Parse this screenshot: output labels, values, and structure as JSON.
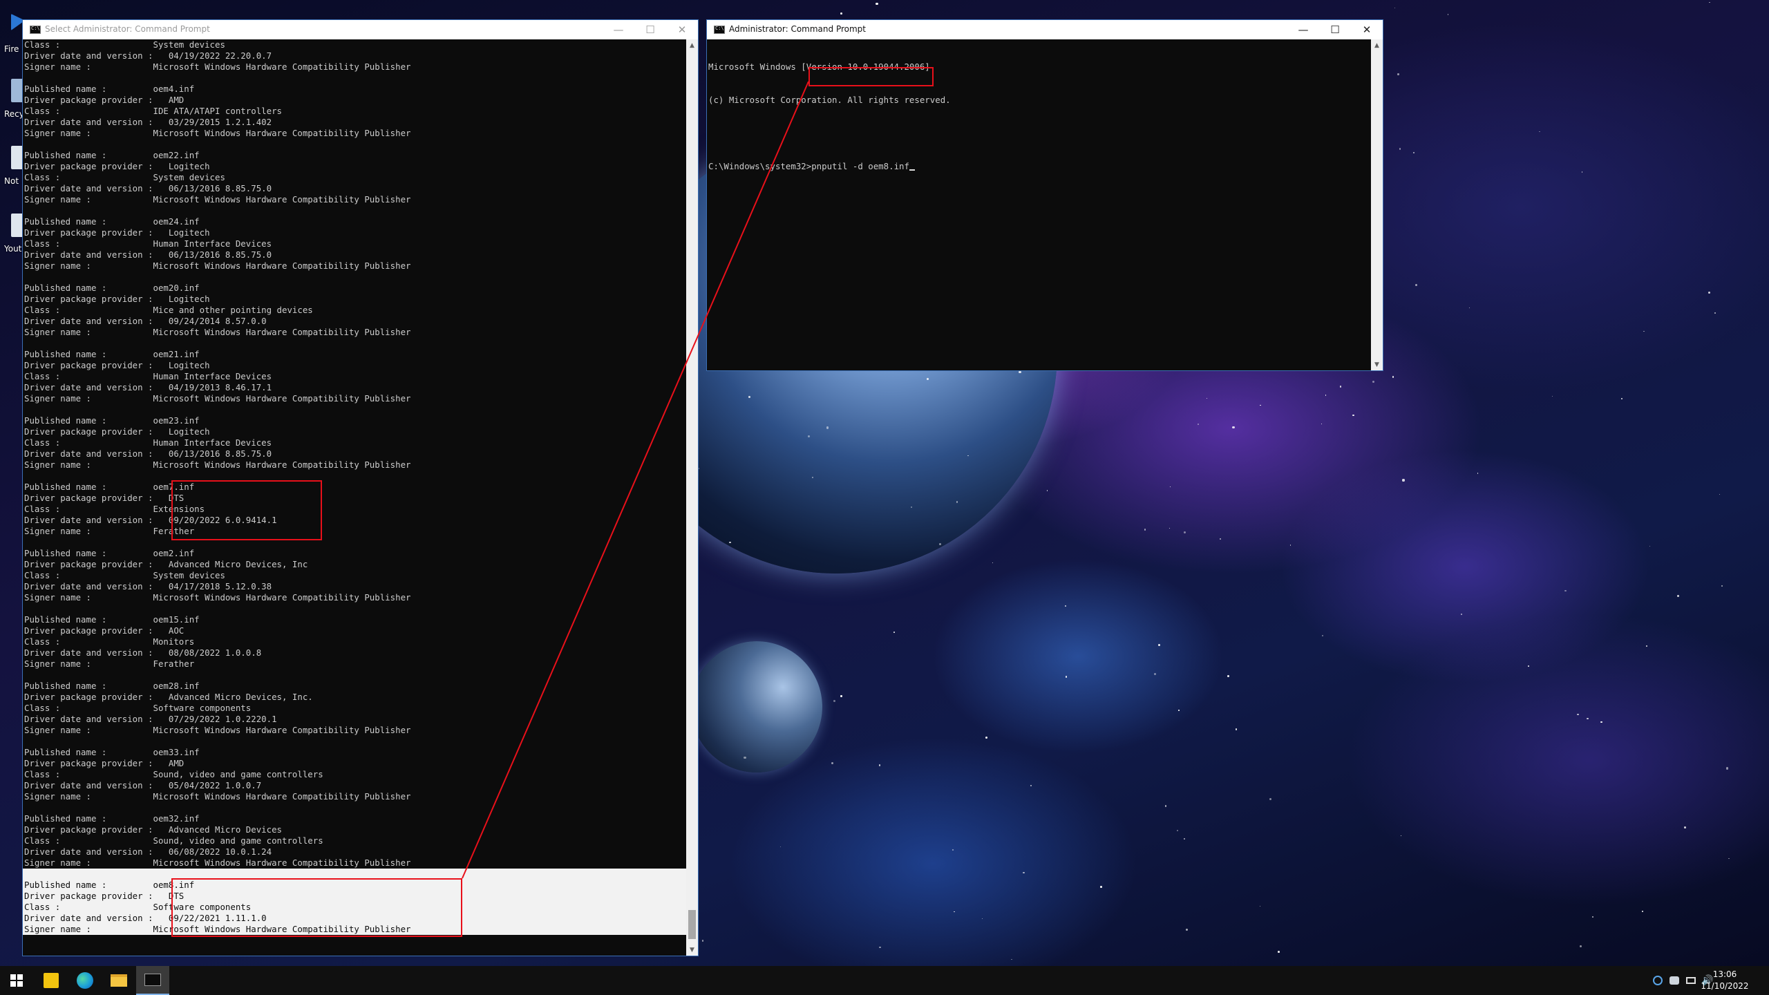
{
  "desktop": {
    "icons": [
      {
        "label": "Fire"
      },
      {
        "label": "Recy"
      },
      {
        "label": "Not"
      },
      {
        "label": "Yout"
      }
    ]
  },
  "left_window": {
    "title": "Select Administrator: Command Prompt",
    "lines": [
      "Class :                  System devices",
      "Driver date and version :   04/19/2022 22.20.0.7",
      "Signer name :            Microsoft Windows Hardware Compatibility Publisher",
      "",
      "Published name :         oem4.inf",
      "Driver package provider :   AMD",
      "Class :                  IDE ATA/ATAPI controllers",
      "Driver date and version :   03/29/2015 1.2.1.402",
      "Signer name :            Microsoft Windows Hardware Compatibility Publisher",
      "",
      "Published name :         oem22.inf",
      "Driver package provider :   Logitech",
      "Class :                  System devices",
      "Driver date and version :   06/13/2016 8.85.75.0",
      "Signer name :            Microsoft Windows Hardware Compatibility Publisher",
      "",
      "Published name :         oem24.inf",
      "Driver package provider :   Logitech",
      "Class :                  Human Interface Devices",
      "Driver date and version :   06/13/2016 8.85.75.0",
      "Signer name :            Microsoft Windows Hardware Compatibility Publisher",
      "",
      "Published name :         oem20.inf",
      "Driver package provider :   Logitech",
      "Class :                  Mice and other pointing devices",
      "Driver date and version :   09/24/2014 8.57.0.0",
      "Signer name :            Microsoft Windows Hardware Compatibility Publisher",
      "",
      "Published name :         oem21.inf",
      "Driver package provider :   Logitech",
      "Class :                  Human Interface Devices",
      "Driver date and version :   04/19/2013 8.46.17.1",
      "Signer name :            Microsoft Windows Hardware Compatibility Publisher",
      "",
      "Published name :         oem23.inf",
      "Driver package provider :   Logitech",
      "Class :                  Human Interface Devices",
      "Driver date and version :   06/13/2016 8.85.75.0",
      "Signer name :            Microsoft Windows Hardware Compatibility Publisher",
      "",
      "Published name :         oem7.inf",
      "Driver package provider :   DTS",
      "Class :                  Extensions",
      "Driver date and version :   09/20/2022 6.0.9414.1",
      "Signer name :            Ferather",
      "",
      "Published name :         oem2.inf",
      "Driver package provider :   Advanced Micro Devices, Inc",
      "Class :                  System devices",
      "Driver date and version :   04/17/2018 5.12.0.38",
      "Signer name :            Microsoft Windows Hardware Compatibility Publisher",
      "",
      "Published name :         oem15.inf",
      "Driver package provider :   AOC",
      "Class :                  Monitors",
      "Driver date and version :   08/08/2022 1.0.0.8",
      "Signer name :            Ferather",
      "",
      "Published name :         oem28.inf",
      "Driver package provider :   Advanced Micro Devices, Inc.",
      "Class :                  Software components",
      "Driver date and version :   07/29/2022 1.0.2220.1",
      "Signer name :            Microsoft Windows Hardware Compatibility Publisher",
      "",
      "Published name :         oem33.inf",
      "Driver package provider :   AMD",
      "Class :                  Sound, video and game controllers",
      "Driver date and version :   05/04/2022 1.0.0.7",
      "Signer name :            Microsoft Windows Hardware Compatibility Publisher",
      "",
      "Published name :         oem32.inf",
      "Driver package provider :   Advanced Micro Devices",
      "Class :                  Sound, video and game controllers",
      "Driver date and version :   06/08/2022 10.0.1.24",
      "Signer name :            Microsoft Windows Hardware Compatibility Publisher",
      "",
      "Published name :         oem8.inf",
      "Driver package provider :   DTS",
      "Class :                  Software components",
      "Driver date and version :   09/22/2021 1.11.1.0",
      "Signer name :            Microsoft Windows Hardware Compatibility Publisher"
    ],
    "selected_from": 75
  },
  "right_window": {
    "title": "Administrator: Command Prompt",
    "lines": [
      "Microsoft Windows [Version 10.0.19044.2006]",
      "(c) Microsoft Corporation. All rights reserved.",
      ""
    ],
    "prompt": "C:\\Windows\\system32",
    "command": ">pnputil -d oem8.inf"
  },
  "annotation_color": "#e8101a",
  "taskbar": {
    "apps": [
      "start-icon",
      "sticky-notes-icon",
      "edge-icon",
      "file-explorer-icon",
      "command-prompt-icon"
    ],
    "tray_icons": [
      "steam-icon",
      "network-users-icon",
      "network-icon",
      "volume-icon"
    ],
    "time": "13:06",
    "date": "11/10/2022"
  }
}
